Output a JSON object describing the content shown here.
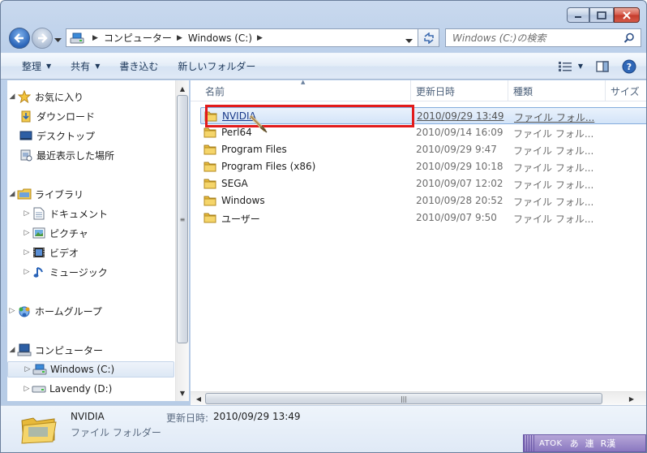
{
  "window": {
    "caption_buttons": [
      "minimize-icon",
      "maximize-icon",
      "close-icon"
    ]
  },
  "address": {
    "path": [
      "コンピューター",
      "Windows (C:)"
    ],
    "search_placeholder": "Windows (C:)の検索"
  },
  "toolbar": {
    "organize": "整理",
    "share": "共有",
    "burn": "書き込む",
    "new_folder": "新しいフォルダー"
  },
  "nav": {
    "favorites": "お気に入り",
    "downloads": "ダウンロード",
    "desktop": "デスクトップ",
    "recent": "最近表示した場所",
    "libraries": "ライブラリ",
    "documents": "ドキュメント",
    "pictures": "ピクチャ",
    "videos": "ビデオ",
    "music": "ミュージック",
    "homegroup": "ホームグループ",
    "computer": "コンピューター",
    "drive_c": "Windows (C:)",
    "drive_d": "Lavendy (D:)"
  },
  "columns": {
    "name": "名前",
    "modified": "更新日時",
    "type": "種類",
    "size": "サイズ"
  },
  "files": [
    {
      "name": "NVIDIA",
      "date": "2010/09/29 13:49",
      "type": "ファイル フォル..."
    },
    {
      "name": "Perl64",
      "date": "2010/09/14 16:09",
      "type": "ファイル フォル..."
    },
    {
      "name": "Program Files",
      "date": "2010/09/29 9:47",
      "type": "ファイル フォル..."
    },
    {
      "name": "Program Files (x86)",
      "date": "2010/09/29 10:18",
      "type": "ファイル フォル..."
    },
    {
      "name": "SEGA",
      "date": "2010/09/07 12:02",
      "type": "ファイル フォル..."
    },
    {
      "name": "Windows",
      "date": "2010/09/28 20:52",
      "type": "ファイル フォル..."
    },
    {
      "name": "ユーザー",
      "date": "2010/09/07 9:50",
      "type": "ファイル フォル..."
    }
  ],
  "details": {
    "name": "NVIDIA",
    "type": "ファイル フォルダー",
    "modified_label": "更新日時:",
    "modified_value": "2010/09/29 13:49"
  },
  "ime": {
    "label": "ATOK",
    "mode1": "あ",
    "mode2": "連",
    "mode3": "R漢"
  },
  "colors": {
    "highlight": "#e21b1b",
    "selection": "#d3e4f8",
    "folder": "#f2c94c"
  }
}
